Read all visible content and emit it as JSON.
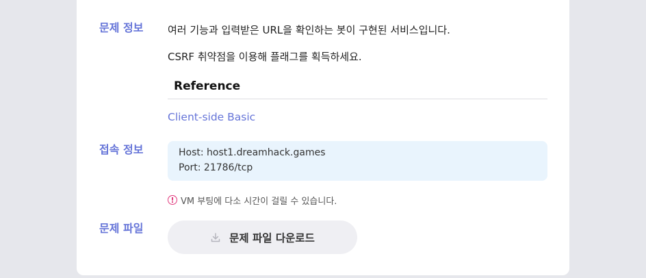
{
  "problem_info": {
    "label": "문제 정보",
    "description_1": "여러 기능과 입력받은 URL을 확인하는 봇이 구현된 서비스입니다.",
    "description_2": "CSRF 취약점을 이용해 플래그를 획득하세요.",
    "reference_title": "Reference",
    "reference_link": "Client-side Basic"
  },
  "connection_info": {
    "label": "접속 정보",
    "host": "Host: host1.dreamhack.games",
    "port": "Port: 21786/tcp",
    "notice": "VM 부팅에 다소 시간이 걸릴 수 있습니다."
  },
  "problem_file": {
    "label": "문제 파일",
    "download_label": "문제 파일 다운로드"
  },
  "icons": {
    "notice": "exclamation-circle-icon",
    "download": "download-icon"
  },
  "colors": {
    "accent": "#6574d8",
    "notice": "#e0357a",
    "connection_bg": "#e9f4fd",
    "button_bg": "#efeff3"
  }
}
